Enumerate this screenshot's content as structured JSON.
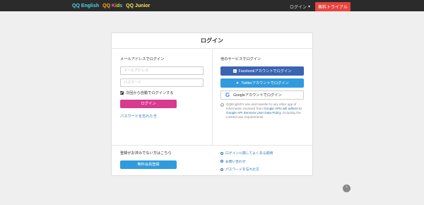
{
  "header": {
    "logo_english": "QQ English",
    "logo_kids_prefix": "QQ ",
    "logo_kids_k": "K",
    "logo_kids_i": "i",
    "logo_kids_d": "d",
    "logo_kids_s": "s",
    "logo_junior": "QQ Junior",
    "login_label": "ログイン",
    "free_trial_label": "無料トライアル"
  },
  "card": {
    "title": "ログイン",
    "email_section": {
      "label": "メールアドレスでログイン",
      "email_placeholder": "メールアドレス",
      "password_placeholder": "パスワード",
      "remember_label": "次回から自動でログインする",
      "login_button": "ログイン",
      "forgot_link": "パスワードを忘れた方"
    },
    "social_section": {
      "label": "他のサービスでログイン",
      "facebook_button": "Facebookアカウントでログイン",
      "twitter_button": "Twitterアカウントでログイン",
      "google_button": "Googleアカウントでログイン",
      "privacy_text_1": "QQEnglish's use and transfer to any other app of information received from ",
      "privacy_link": "Google APIs will adhere to Google API Services User Data Policy",
      "privacy_text_2": ", including the Limited Use requirements."
    },
    "register_section": {
      "label": "登録がお済みでない方はこちら",
      "register_button": "無料会員登録"
    },
    "help_links": [
      "ログインに関してよくある質問",
      "お問い合わせ",
      "パスワードを忘れた方"
    ]
  },
  "colors": {
    "login_button": "#d9398f",
    "facebook": "#3b64b3",
    "twitter": "#2f9bde",
    "free_trial": "#e8433d"
  }
}
